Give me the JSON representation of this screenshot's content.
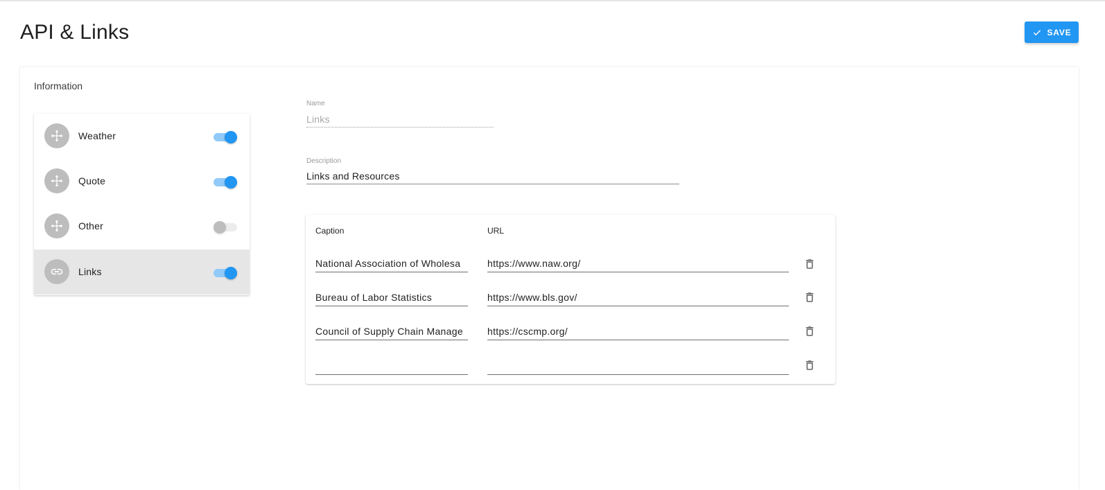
{
  "page": {
    "title": "API & Links"
  },
  "toolbar": {
    "save_label": "SAVE"
  },
  "card": {
    "title": "Information"
  },
  "widgets": [
    {
      "label": "Weather",
      "icon": "move-icon",
      "enabled": true,
      "active": false
    },
    {
      "label": "Quote",
      "icon": "move-icon",
      "enabled": true,
      "active": false
    },
    {
      "label": "Other",
      "icon": "move-icon",
      "enabled": false,
      "active": false
    },
    {
      "label": "Links",
      "icon": "link-icon",
      "enabled": true,
      "active": true
    }
  ],
  "form": {
    "name": {
      "label": "Name",
      "value": "Links"
    },
    "description": {
      "label": "Description",
      "value": "Links and Resources"
    }
  },
  "links_table": {
    "headers": {
      "caption": "Caption",
      "url": "URL"
    },
    "rows": [
      {
        "caption": "National Association of Wholesa",
        "url": "https://www.naw.org/"
      },
      {
        "caption": "Bureau of Labor Statistics",
        "url": "https://www.bls.gov/"
      },
      {
        "caption": "Council of Supply Chain Manage",
        "url": "https://cscmp.org/"
      },
      {
        "caption": "",
        "url": ""
      }
    ]
  },
  "colors": {
    "accent": "#2196f3",
    "switch_track_on": "#90caf9",
    "active_row_bg": "#e6e6e6",
    "avatar_bg": "#bdbdbd"
  }
}
